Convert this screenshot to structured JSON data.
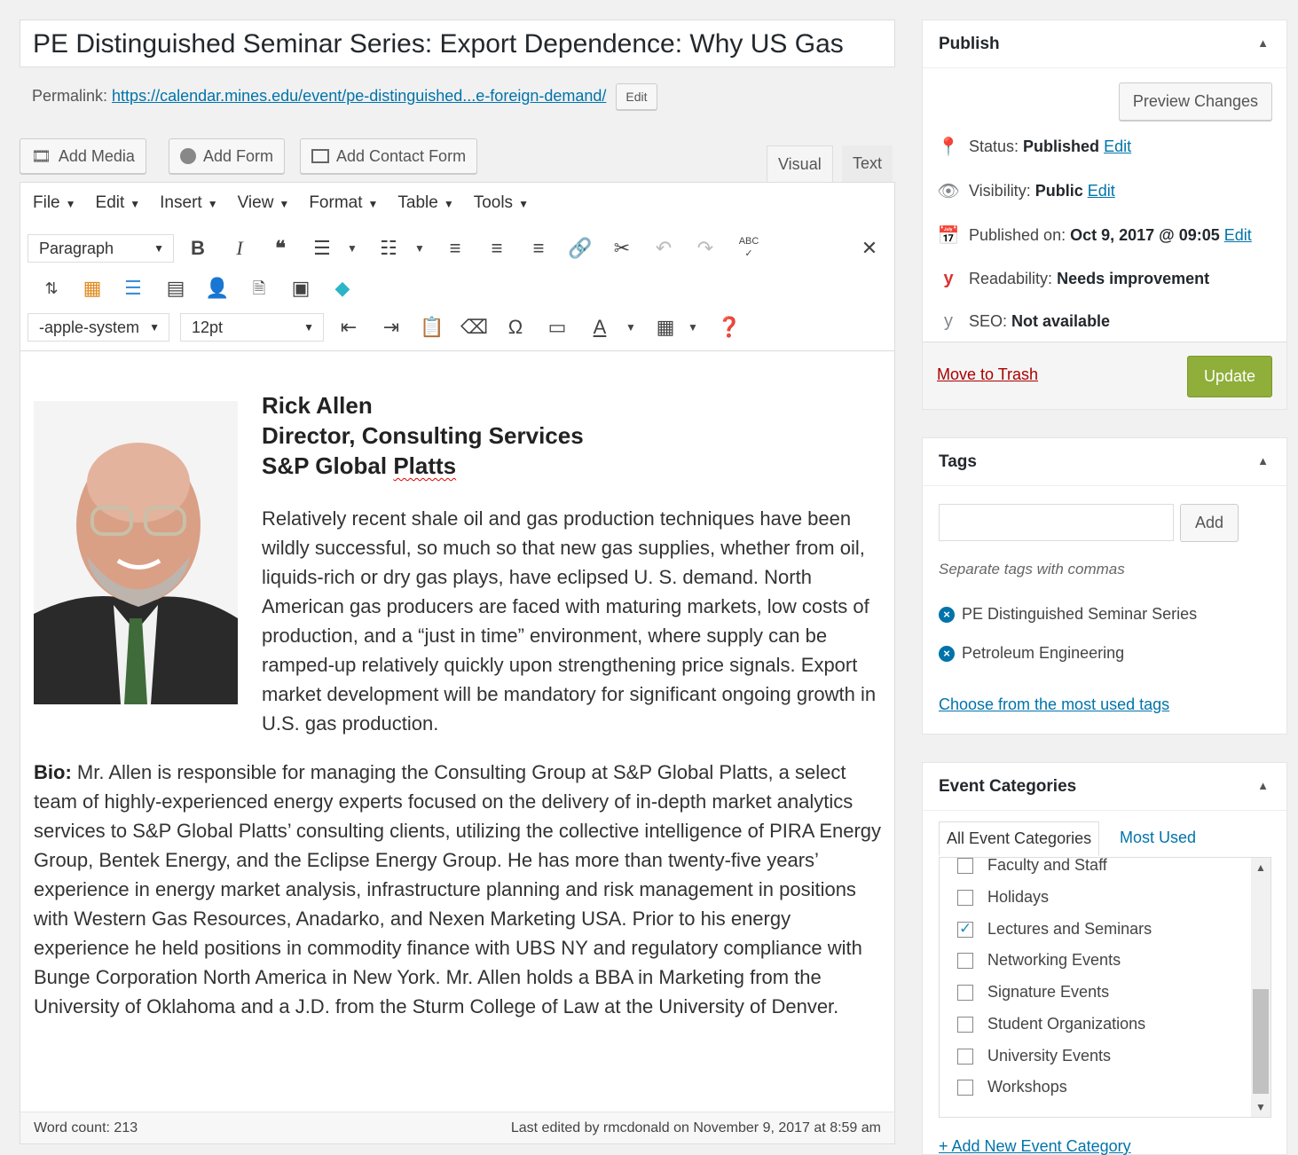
{
  "post": {
    "title": "PE Distinguished Seminar Series: Export Dependence:  Why US Gas",
    "permalink_label": "Permalink:",
    "permalink_url": "https://calendar.mines.edu/event/pe-distinguished...e-foreign-demand/",
    "permalink_edit": "Edit"
  },
  "media_buttons": {
    "add_media": "Add Media",
    "add_form": "Add Form",
    "add_contact_form": "Add Contact Form"
  },
  "editor_tabs": {
    "visual": "Visual",
    "text": "Text"
  },
  "menubar": [
    "File",
    "Edit",
    "Insert",
    "View",
    "Format",
    "Table",
    "Tools"
  ],
  "toolbar": {
    "block_format": "Paragraph",
    "font_family": "-apple-system",
    "font_size": "12pt"
  },
  "content": {
    "speaker_name": "Rick Allen",
    "speaker_title": "Director, Consulting Services",
    "speaker_org_prefix": "S&P Global ",
    "speaker_org_word": "Platts",
    "abstract": "Relatively recent shale oil and gas production techniques have been wildly successful, so much so that new gas supplies, whether from oil, liquids-rich or dry gas plays, have eclipsed U. S. demand. North American gas producers are faced with maturing markets, low costs of production, and a “just in time” environment, where supply can be ramped-up relatively quickly upon strengthening price signals. Export market development will be mandatory for significant ongoing growth in U.S. gas production.",
    "bio_label": "Bio:",
    "bio": " Mr. Allen is responsible for managing the Consulting Group at S&P Global Platts, a select team of highly-experienced energy experts focused on the delivery of in-depth market analytics services to S&P Global Platts’ consulting clients, utilizing the collective intelligence of PIRA Energy Group, Bentek Energy, and the Eclipse Energy Group. He has more than twenty-five years’ experience in energy market analysis, infrastructure planning and risk management in positions with Western Gas Resources, Anadarko, and Nexen Marketing USA. Prior to his energy experience he held positions in commodity finance with UBS NY and regulatory compliance with Bunge Corporation North America in New York. Mr. Allen holds a BBA in Marketing from the University of Oklahoma and a J.D. from the Sturm College of Law at the University of Denver."
  },
  "status_bar": {
    "word_count": "Word count: 213",
    "last_edited": "Last edited by rmcdonald on November 9, 2017 at 8:59 am"
  },
  "publish": {
    "heading": "Publish",
    "preview_changes": "Preview Changes",
    "status_label": "Status:",
    "status_value": "Published",
    "visibility_label": "Visibility:",
    "visibility_value": "Public",
    "published_label": "Published on:",
    "published_value": "Oct 9, 2017 @ 09:05",
    "readability_label": "Readability:",
    "readability_value": "Needs improvement",
    "seo_label": "SEO:",
    "seo_value": "Not available",
    "edit_link": "Edit",
    "move_to_trash": "Move to Trash",
    "update": "Update"
  },
  "tags": {
    "heading": "Tags",
    "input_value": "",
    "add": "Add",
    "help": "Separate tags with commas",
    "items": [
      "PE Distinguished Seminar Series",
      "Petroleum Engineering"
    ],
    "choose_link": "Choose from the most used tags"
  },
  "event_categories": {
    "heading": "Event Categories",
    "tab_all": "All Event Categories",
    "tab_most_used": "Most Used",
    "items": [
      {
        "label": "Faculty and Staff",
        "checked": false
      },
      {
        "label": "Holidays",
        "checked": false
      },
      {
        "label": "Lectures and Seminars",
        "checked": true
      },
      {
        "label": "Networking Events",
        "checked": false
      },
      {
        "label": "Signature Events",
        "checked": false
      },
      {
        "label": "Student Organizations",
        "checked": false
      },
      {
        "label": "University Events",
        "checked": false
      },
      {
        "label": "Workshops",
        "checked": false
      }
    ],
    "add_new": "+ Add New Event Category"
  },
  "colors": {
    "link": "#0073aa",
    "update_button": "#8fae3a",
    "trash": "#aa0000",
    "yoast_red": "#dc3232"
  }
}
